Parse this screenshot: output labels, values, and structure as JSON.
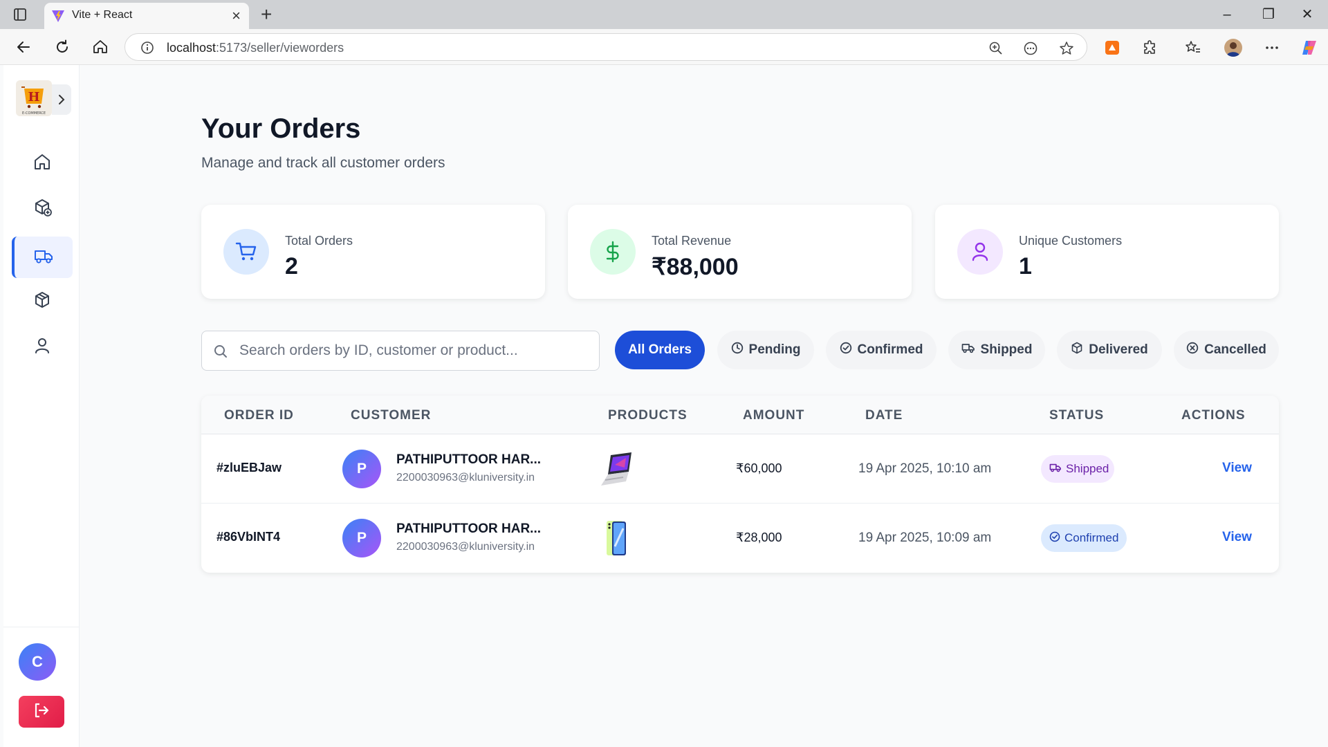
{
  "browser": {
    "tab_title": "Vite + React",
    "url_host": "localhost",
    "url_rest": ":5173/seller/vieworders"
  },
  "page": {
    "title": "Your Orders",
    "subtitle": "Manage and track all customer orders"
  },
  "stats": [
    {
      "label": "Total Orders",
      "value": "2",
      "icon": "cart-icon",
      "color": "#2563eb",
      "bg": "#dbeafe"
    },
    {
      "label": "Total Revenue",
      "value": "₹88,000",
      "icon": "dollar-icon",
      "color": "#16a34a",
      "bg": "#dcfce7"
    },
    {
      "label": "Unique Customers",
      "value": "1",
      "icon": "user-icon",
      "color": "#9333ea",
      "bg": "#f3e8ff"
    }
  ],
  "search": {
    "placeholder": "Search orders by ID, customer or product..."
  },
  "filters": [
    {
      "label": "All Orders",
      "active": true
    },
    {
      "label": "Pending",
      "icon": "clock-icon"
    },
    {
      "label": "Confirmed",
      "icon": "check-circle-icon"
    },
    {
      "label": "Shipped",
      "icon": "truck-icon"
    },
    {
      "label": "Delivered",
      "icon": "package-icon"
    },
    {
      "label": "Cancelled",
      "icon": "x-circle-icon"
    }
  ],
  "table": {
    "headers": [
      "ORDER ID",
      "CUSTOMER",
      "PRODUCTS",
      "AMOUNT",
      "DATE",
      "STATUS",
      "ACTIONS"
    ],
    "rows": [
      {
        "order_id": "#zluEBJaw",
        "avatar_letter": "P",
        "customer_name": "PATHIPUTTOOR HAR...",
        "customer_email": "2200030963@kluniversity.in",
        "product_icon": "laptop-thumbnail",
        "amount": "₹60,000",
        "date": "19 Apr 2025, 10:10 am",
        "status": "Shipped",
        "action": "View"
      },
      {
        "order_id": "#86VbINT4",
        "avatar_letter": "P",
        "customer_name": "PATHIPUTTOOR HAR...",
        "customer_email": "2200030963@kluniversity.in",
        "product_icon": "phone-thumbnail",
        "amount": "₹28,000",
        "date": "19 Apr 2025, 10:09 am",
        "status": "Confirmed",
        "action": "View"
      }
    ]
  },
  "sidebar": {
    "user_initial": "C",
    "items": [
      "home-icon",
      "add-product-icon",
      "orders-truck-icon",
      "products-box-icon",
      "profile-icon"
    ],
    "active_item": "orders-truck-icon"
  },
  "colors": {
    "accent": "#1d4ed8",
    "link": "#2563eb",
    "logout": "#e11d48"
  }
}
